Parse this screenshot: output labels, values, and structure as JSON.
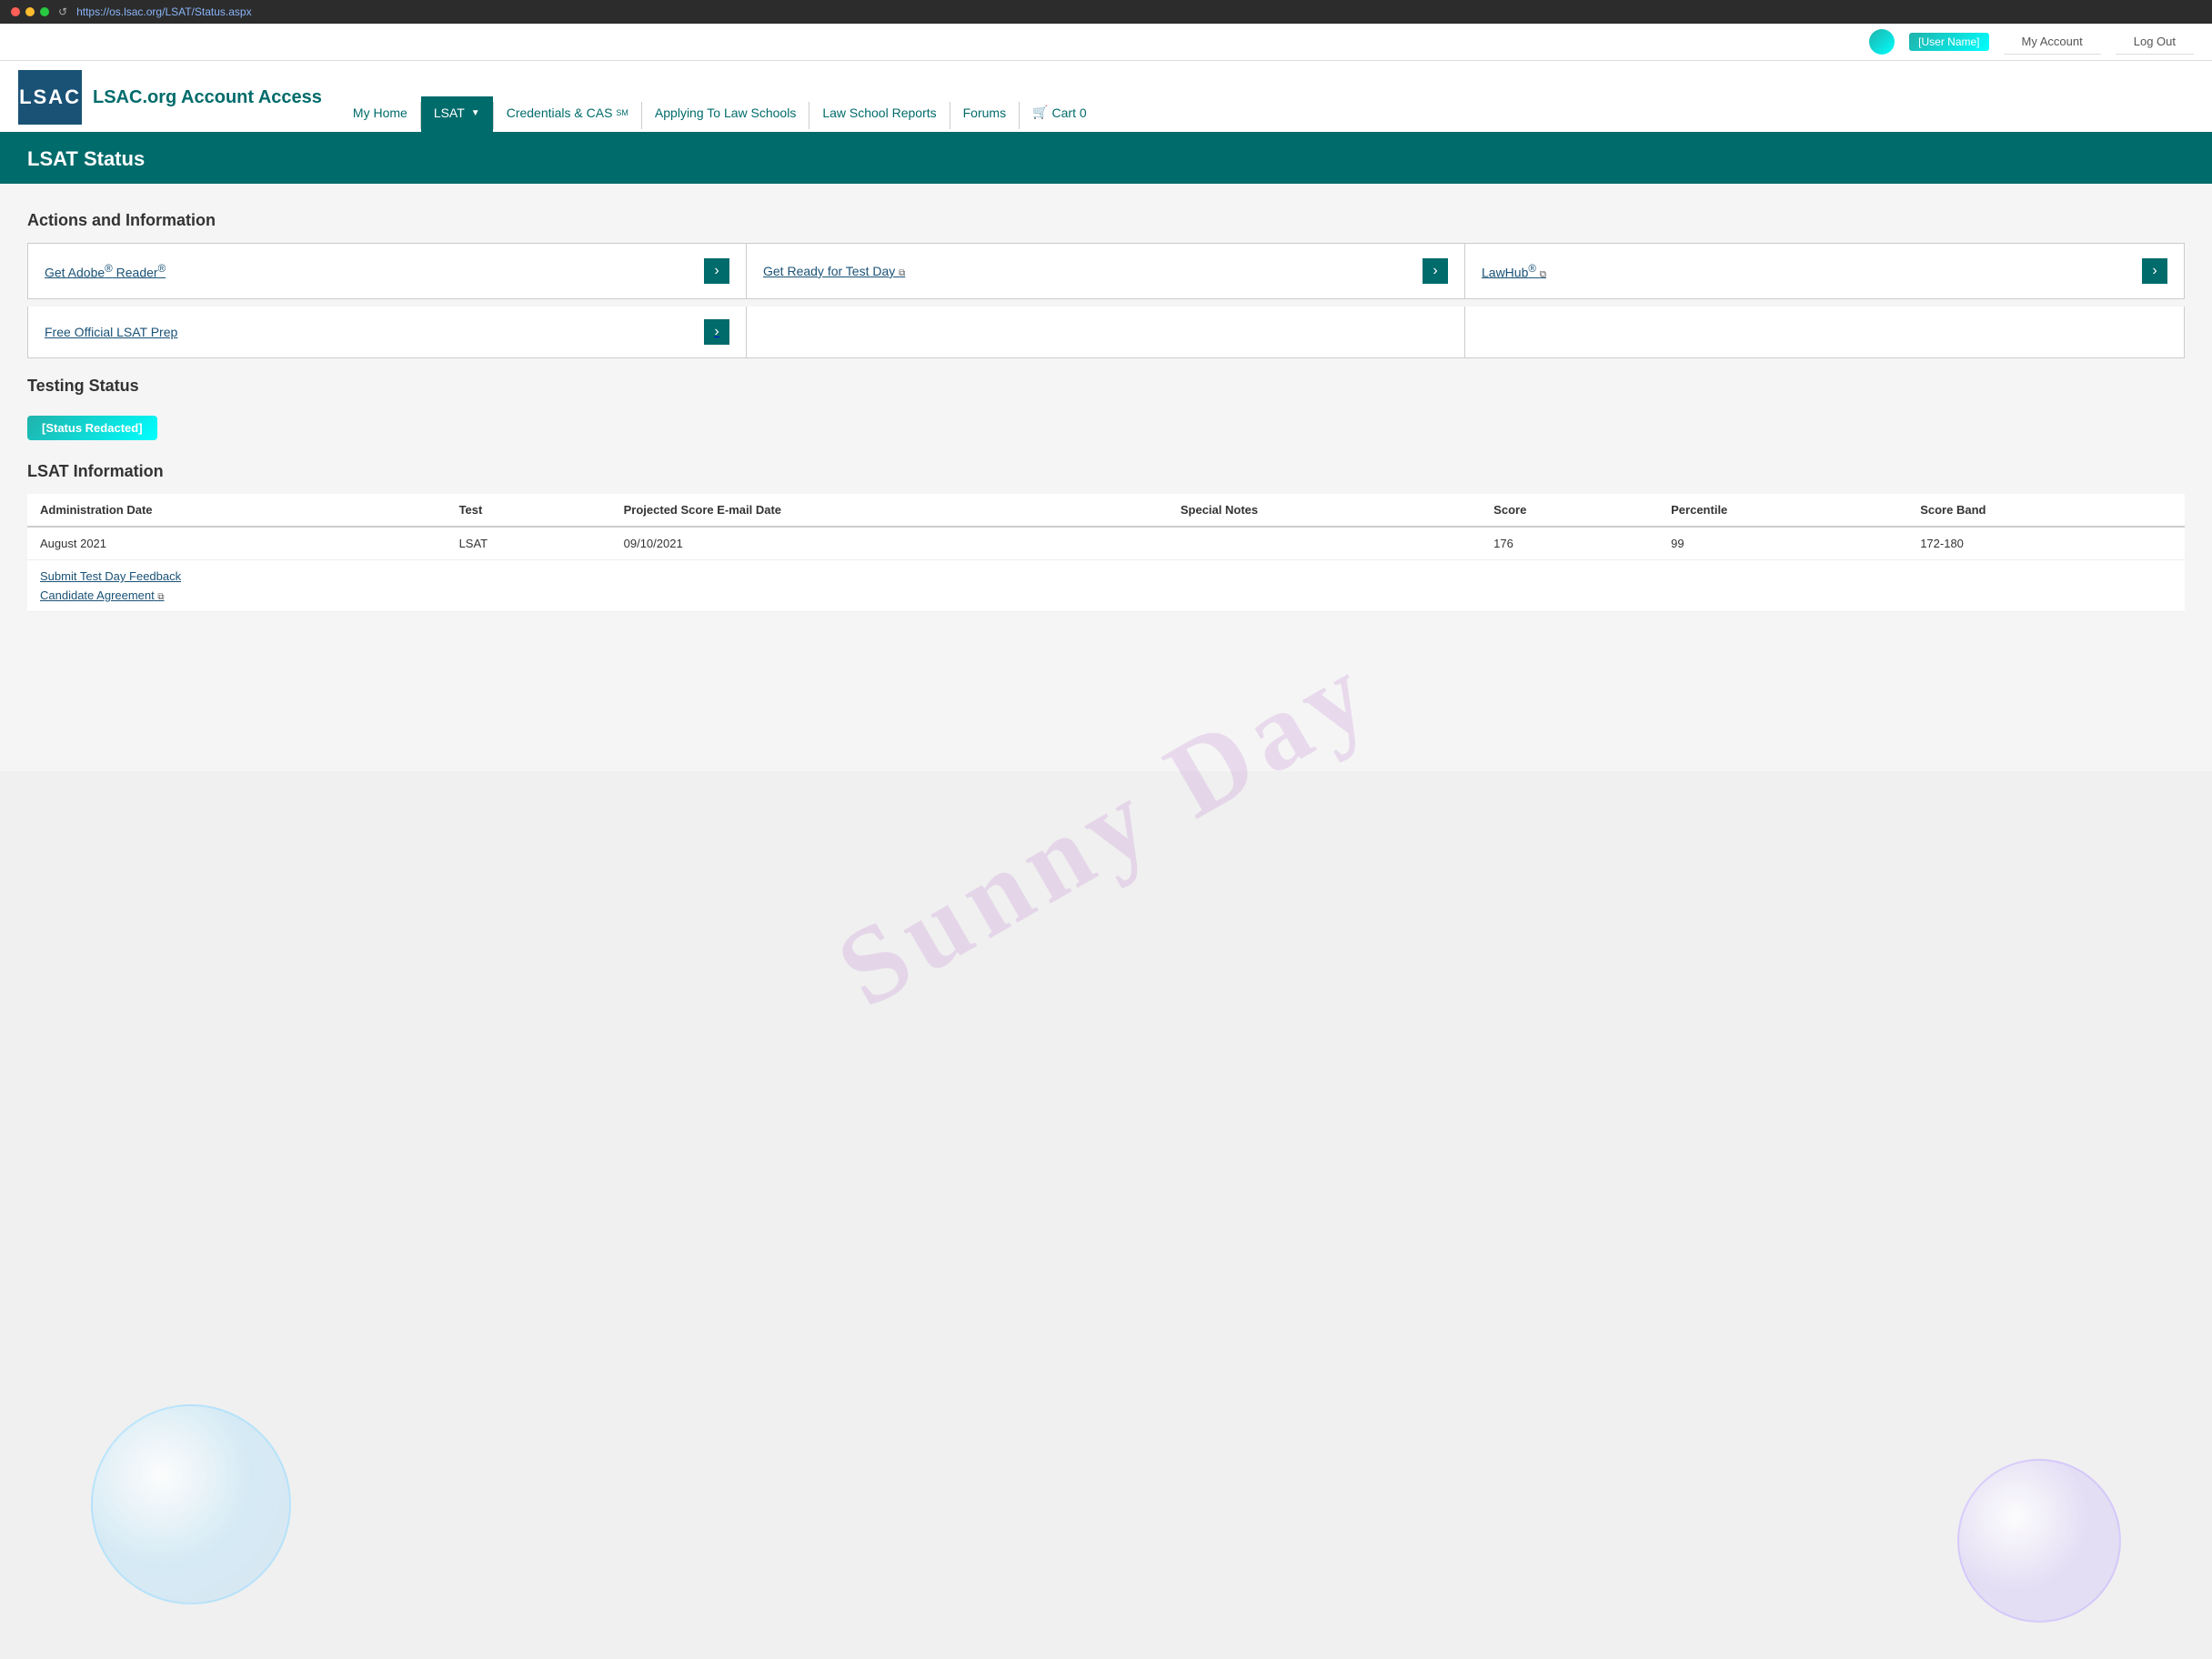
{
  "browser": {
    "url": "https://os.lsac.org/LSAT/Status.aspx"
  },
  "account_bar": {
    "my_account": "My Account",
    "log_out": "Log Out"
  },
  "site": {
    "title": "LSAC.org Account Access",
    "logo_text": "LSAC"
  },
  "nav": {
    "items": [
      {
        "id": "my-home",
        "label": "My Home",
        "active": false
      },
      {
        "id": "lsat",
        "label": "LSAT",
        "active": true,
        "has_dropdown": true
      },
      {
        "id": "credentials-cas",
        "label": "Credentials & CAS",
        "superscript": "SM",
        "active": false
      },
      {
        "id": "applying",
        "label": "Applying To Law Schools",
        "active": false
      },
      {
        "id": "law-school-reports",
        "label": "Law School Reports",
        "active": false
      },
      {
        "id": "forums",
        "label": "Forums",
        "active": false
      },
      {
        "id": "cart",
        "label": "Cart 0",
        "active": false
      }
    ]
  },
  "page": {
    "status_header": {
      "prefix": "LSAT",
      "title": "Status"
    },
    "actions_section": {
      "title": "Actions and Information",
      "cards_row1": [
        {
          "text": "Get Adobe® Reader®",
          "has_link": true
        },
        {
          "text": "Get Ready for Test Day",
          "has_ext": true
        },
        {
          "text": "LawHub®",
          "has_ext": true
        }
      ],
      "cards_row2": [
        {
          "text": "Free Official LSAT Prep",
          "has_link": true
        },
        {
          "text": "",
          "empty": true
        },
        {
          "text": "",
          "empty": true
        }
      ]
    },
    "testing_status": {
      "title": "Testing Status",
      "status_value": "[Redacted]"
    },
    "lsat_information": {
      "title": "LSAT Information",
      "table_headers": [
        "Administration Date",
        "Test",
        "Projected Score E-mail Date",
        "Special Notes",
        "Score",
        "Percentile",
        "Score Band"
      ],
      "rows": [
        {
          "admin_date": "August 2021",
          "test": "LSAT",
          "projected_email": "09/10/2021",
          "special_notes": "",
          "score": "176",
          "percentile": "99",
          "score_band": "172-180"
        }
      ],
      "submit_feedback_label": "Submit Test Day Feedback",
      "candidate_agreement_label": "Candidate Agreement",
      "ext_icon": "🔗"
    }
  }
}
